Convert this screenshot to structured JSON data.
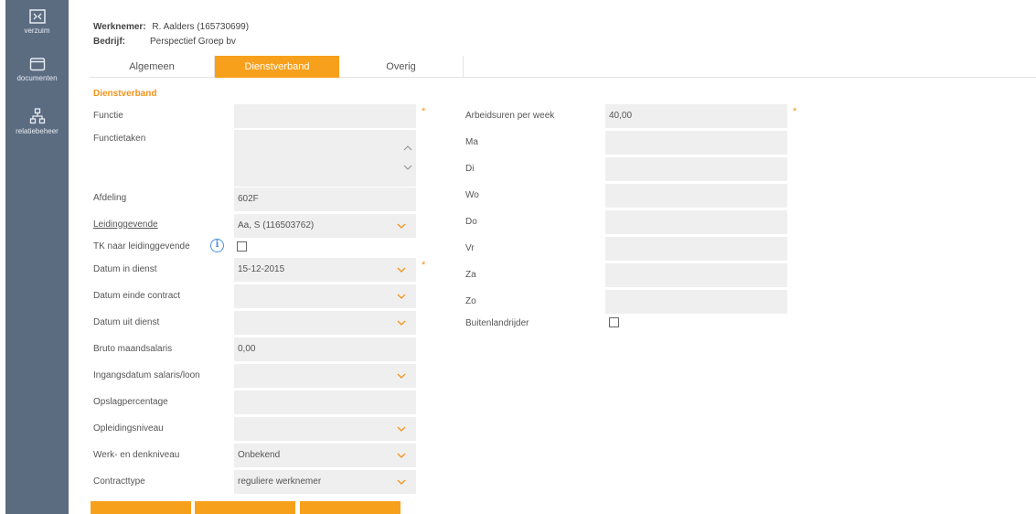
{
  "sidebar": {
    "items": [
      {
        "label": "verzuim",
        "icon": "calendar-icon"
      },
      {
        "label": "documenten",
        "icon": "folder-icon"
      },
      {
        "label": "relatiebeheer",
        "icon": "org-chart-icon"
      }
    ]
  },
  "header": {
    "werknemer_label": "Werknemer:",
    "werknemer_value": "R. Aalders (165730699)",
    "bedrijf_label": "Bedrijf:",
    "bedrijf_value": "Perspectief Groep bv"
  },
  "tabs": [
    {
      "label": "Algemeen",
      "active": false
    },
    {
      "label": "Dienstverband",
      "active": true
    },
    {
      "label": "Overig",
      "active": false
    }
  ],
  "section_title": "Dienstverband",
  "left_fields": [
    {
      "label": "Functie",
      "value": "",
      "required": true
    },
    {
      "label": "Functietaken",
      "value": ""
    },
    {
      "label": "Afdeling",
      "value": "602F"
    },
    {
      "label": "Leidinggevende",
      "value": "Aa, S (116503762)"
    },
    {
      "label": "TK naar leidinggevende",
      "checked": false
    },
    {
      "label": "Datum in dienst",
      "value": "15-12-2015",
      "required": true
    },
    {
      "label": "Datum einde contract",
      "value": ""
    },
    {
      "label": "Datum uit dienst",
      "value": ""
    },
    {
      "label": "Bruto maandsalaris",
      "value": "0,00"
    },
    {
      "label": "Ingangsdatum salaris/loon",
      "value": ""
    },
    {
      "label": "Opslagpercentage",
      "value": ""
    },
    {
      "label": "Opleidingsniveau",
      "value": ""
    },
    {
      "label": "Werk- en denkniveau",
      "value": "Onbekend"
    },
    {
      "label": "Contracttype",
      "value": "reguliere werknemer"
    }
  ],
  "right_fields": [
    {
      "label": "Arbeidsuren per week",
      "value": "40,00",
      "required": true
    },
    {
      "label": "Ma",
      "value": ""
    },
    {
      "label": "Di",
      "value": ""
    },
    {
      "label": "Wo",
      "value": ""
    },
    {
      "label": "Do",
      "value": ""
    },
    {
      "label": "Vr",
      "value": ""
    },
    {
      "label": "Za",
      "value": ""
    },
    {
      "label": "Zo",
      "value": ""
    },
    {
      "label": "Buitenlandrijder",
      "checked": false
    }
  ],
  "colors": {
    "accent": "#f7a01b",
    "sidebar": "#5b6b80",
    "field": "#efefef"
  }
}
